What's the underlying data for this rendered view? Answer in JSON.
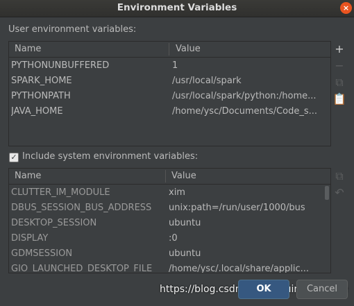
{
  "window": {
    "title": "Environment Variables",
    "close_symbol": "×"
  },
  "user_section": {
    "label": "User environment variables:",
    "columns": [
      "Name",
      "Value"
    ],
    "rows": [
      {
        "name": "PYTHONUNBUFFERED",
        "value": "1"
      },
      {
        "name": "SPARK_HOME",
        "value": "/usr/local/spark"
      },
      {
        "name": "PYTHONPATH",
        "value": "/usr/local/spark/python:/home..."
      },
      {
        "name": "JAVA_HOME",
        "value": "/home/ysc/Documents/Code_s..."
      }
    ],
    "toolbar": [
      {
        "icon": "add-icon",
        "glyph": "+",
        "enabled": true
      },
      {
        "icon": "remove-icon",
        "glyph": "−",
        "enabled": false
      },
      {
        "icon": "copy-icon",
        "glyph": "⧉",
        "enabled": false
      },
      {
        "icon": "paste-icon",
        "glyph": "📋",
        "enabled": true
      }
    ]
  },
  "system_section": {
    "checkbox_label": "Include system environment variables:",
    "checked": true,
    "columns": [
      "Name",
      "Value"
    ],
    "rows": [
      {
        "name": "CLUTTER_IM_MODULE",
        "value": "xim"
      },
      {
        "name": "DBUS_SESSION_BUS_ADDRESS",
        "value": "unix:path=/run/user/1000/bus"
      },
      {
        "name": "DESKTOP_SESSION",
        "value": "ubuntu"
      },
      {
        "name": "DISPLAY",
        "value": ":0"
      },
      {
        "name": "GDMSESSION",
        "value": "ubuntu"
      },
      {
        "name": "GIO_LAUNCHED_DESKTOP_FILE",
        "value": "/home/ysc/.local/share/applic..."
      }
    ],
    "toolbar": [
      {
        "icon": "copy-icon",
        "glyph": "⧉",
        "enabled": false
      },
      {
        "icon": "undo-icon",
        "glyph": "↶",
        "enabled": false
      }
    ]
  },
  "buttons": {
    "ok": "OK",
    "cancel": "Cancel"
  },
  "watermark": "https://blog.csdn.net/pursuingparadise",
  "colors": {
    "background": "#3c3f41",
    "ok_button": "#365880",
    "close_button": "#e95420"
  }
}
